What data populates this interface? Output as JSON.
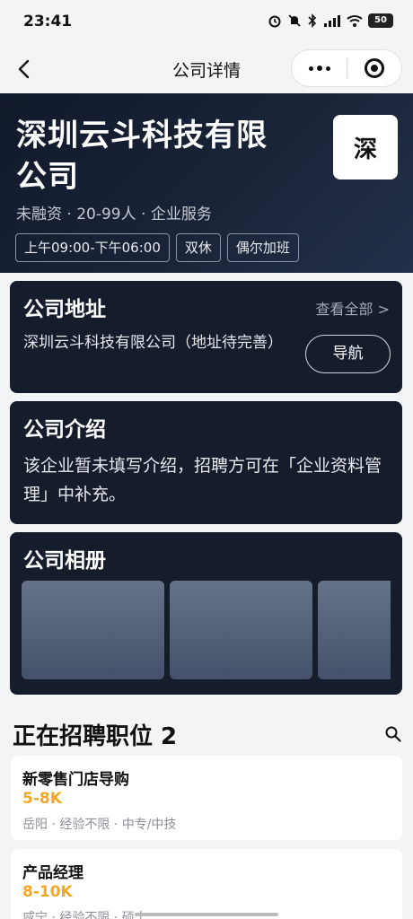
{
  "status": {
    "time": "23:41",
    "battery": "50"
  },
  "nav": {
    "title": "公司详情"
  },
  "company": {
    "name": "深圳云斗科技有限公司",
    "logo_text": "深",
    "meta": "未融资 · 20-99人 · 企业服务",
    "tags": [
      "上午09:00-下午06:00",
      "双休",
      "偶尔加班"
    ]
  },
  "address": {
    "title": "公司地址",
    "view_all": "查看全部 >",
    "text": "深圳云斗科技有限公司（地址待完善）",
    "nav_button": "导航"
  },
  "intro": {
    "title": "公司介绍",
    "text": "该企业暂未填写介绍，招聘方可在「企业资料管理」中补充。"
  },
  "album": {
    "title": "公司相册"
  },
  "jobs": {
    "title": "正在招聘职位 2",
    "items": [
      {
        "name": "新零售门店导购",
        "salary": "5-8K",
        "meta": "岳阳 · 经验不限 · 中专/中技"
      },
      {
        "name": "产品经理",
        "salary": "8-10K",
        "meta": "咸宁 · 经验不限 · 硕士"
      }
    ]
  },
  "colors": {
    "hero_bg": "#111a2b",
    "card_bg": "#151c2c",
    "salary": "#f5a623"
  }
}
